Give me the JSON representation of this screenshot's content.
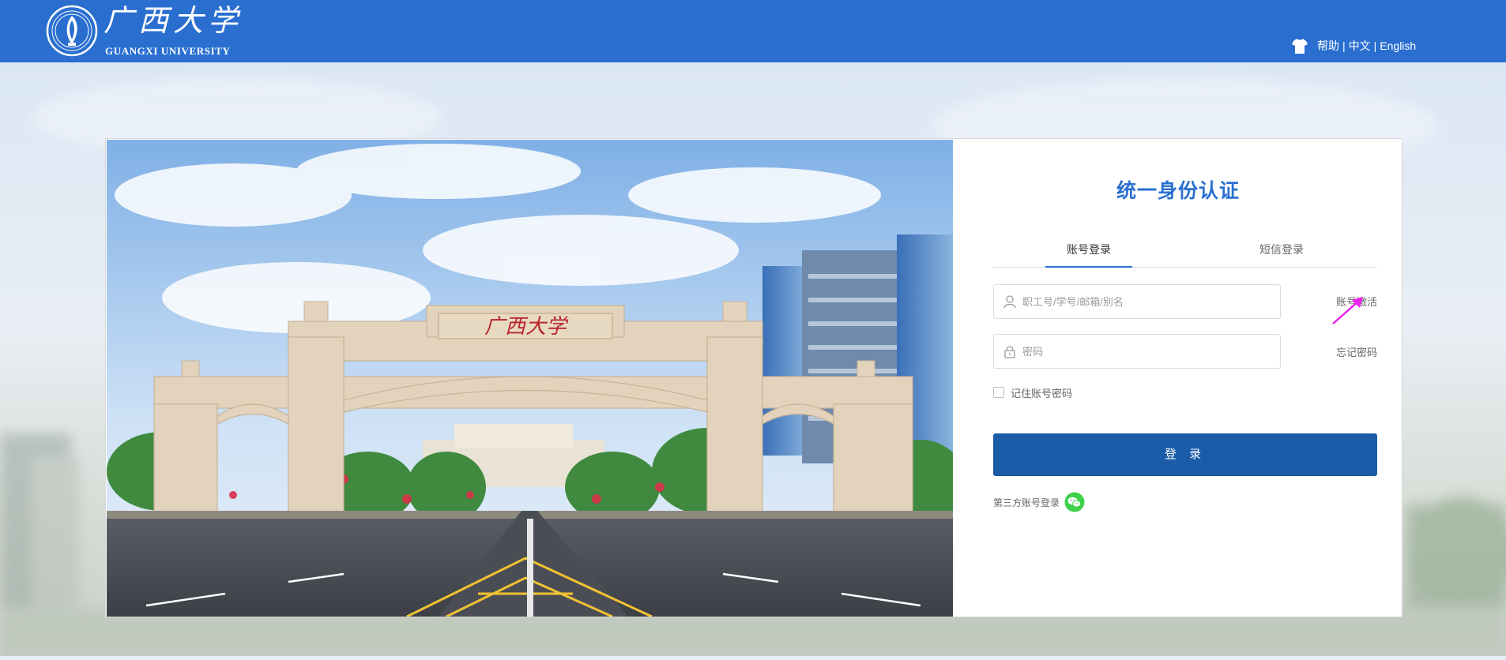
{
  "header": {
    "logo_cn": "广西大学",
    "logo_en": "GUANGXI UNIVERSITY",
    "help": "帮助",
    "chinese": "中文",
    "english": "English",
    "separator": "|",
    "icon_shirt": "tshirt-icon"
  },
  "banner": {
    "gate_sign": "广西大学"
  },
  "login": {
    "title": "统一身份认证",
    "tabs": [
      {
        "label": "账号登录",
        "active": true
      },
      {
        "label": "短信登录",
        "active": false
      }
    ],
    "username": {
      "placeholder": "职工号/学号/邮箱/别名",
      "value": ""
    },
    "password": {
      "placeholder": "密码",
      "value": ""
    },
    "activate_link": "账号激活",
    "forgot_link": "忘记密码",
    "remember_label": "记住账号密码",
    "remember_checked": false,
    "login_button": "登 录",
    "third_party_label": "第三方账号登录",
    "wechat_icon": "wechat-icon"
  },
  "colors": {
    "header": "#2a6fd0",
    "title": "#2a6fd0",
    "button": "#1b5ca8",
    "wechat": "#3fd14a",
    "arrow": "#ee22ee"
  }
}
